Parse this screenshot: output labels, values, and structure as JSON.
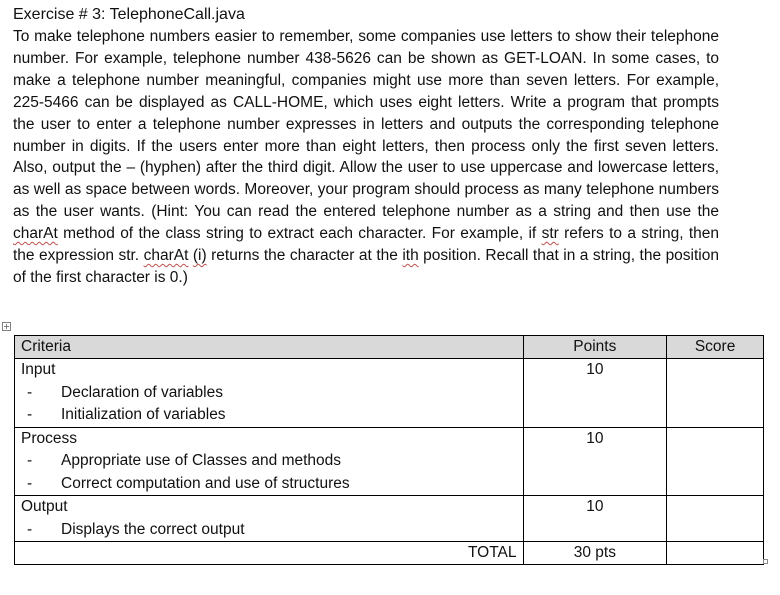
{
  "exercise": {
    "title": "Exercise # 3: TelephoneCall.java",
    "description": {
      "part1": "To make telephone numbers easier to remember, some companies use letters to show their telephone number. For example, telephone number 438-5626 can be shown as GET-LOAN. In some cases, to make a telephone number meaningful, companies might use more than seven letters. For example, 225-5466 can be displayed as CALL-HOME, which uses eight letters. Write a program that prompts the user to enter a telephone number expresses in letters and outputs the corresponding telephone number in digits. If the users enter more than eight letters, then process only the first seven letters. Also, output the – (hyphen) after the third digit. Allow the user to use uppercase and lowercase letters, as well as space between words. Moreover, your program should process as many telephone numbers as the user wants. (Hint: You can read the entered telephone number as a string and then use the ",
      "charAt": "charAt",
      "part2": " method ",
      "method": "method",
      "part3": " of the class string to extract each character. For example, if ",
      "str": "str",
      "part4": " refers to a string, then the expression str. ",
      "charAt2": "charAt",
      "part5": " ",
      "i": "(i)",
      "part6": " returns the character at the ",
      "ith": "ith",
      "part7": " position. Recall that in a string, the position of the first character is 0.)"
    }
  },
  "rubric": {
    "headers": {
      "criteria": "Criteria",
      "points": "Points",
      "score": "Score"
    },
    "rows": [
      {
        "criterion": "Input",
        "items": [
          "Declaration of variables",
          "Initialization of variables"
        ],
        "points": "10",
        "score": ""
      },
      {
        "criterion": "Process",
        "items": [
          "Appropriate use of Classes and methods",
          "Correct computation and use of structures"
        ],
        "points": "10",
        "score": ""
      },
      {
        "criterion": "Output",
        "items": [
          "Displays the correct output"
        ],
        "points": "10",
        "score": ""
      }
    ],
    "total": {
      "label": "TOTAL",
      "points": "30 pts",
      "score": ""
    },
    "bullet": "-"
  }
}
